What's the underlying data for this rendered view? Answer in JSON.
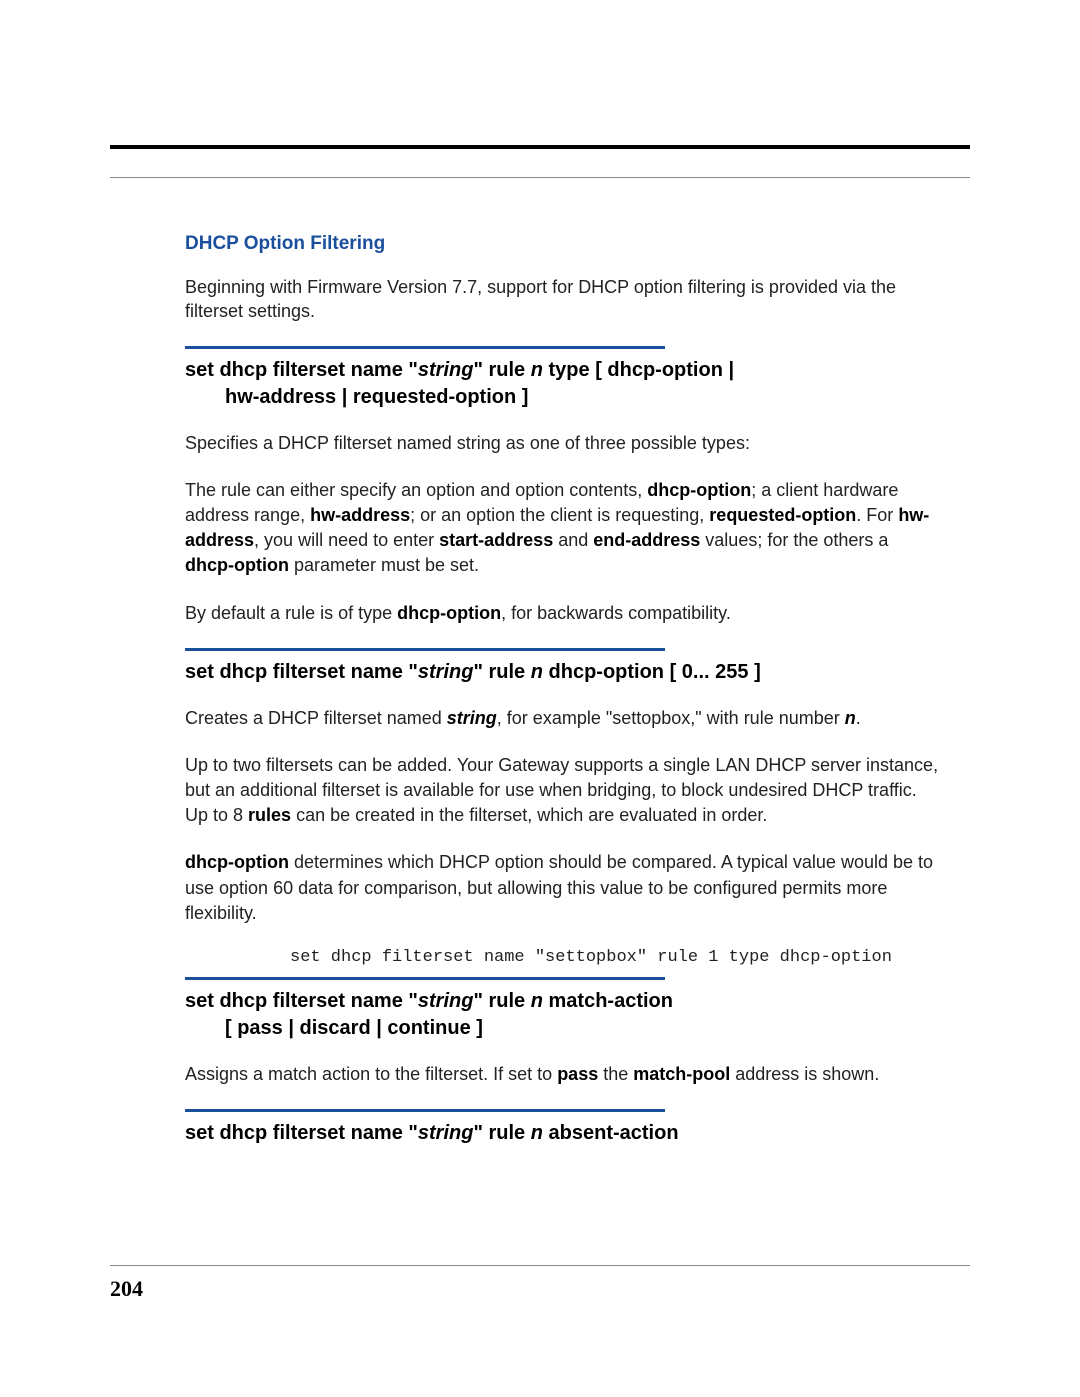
{
  "section": {
    "heading": "DHCP Option Filtering",
    "intro": "Beginning with Firmware Version 7.7, support for DHCP option filtering is provided via the filterset settings."
  },
  "cmd1": {
    "prefix": "set dhcp filterset name \"",
    "param1": "string",
    "mid1": "\" rule ",
    "param2": "n",
    "mid2": " type [ dhcp-option |",
    "line2": "hw-address | requested-option ]",
    "desc": "Specifies a DHCP filterset named string as one of three possible types:",
    "para2_a": "The rule can either specify an option and option contents, ",
    "para2_b": "dhcp-option",
    "para2_c": "; a client hardware address range, ",
    "para2_d": "hw-address",
    "para2_e": "; or an option the client is requesting, ",
    "para2_f": "requested-option",
    "para2_g": ". For ",
    "para2_h": "hw-address",
    "para2_i": ", you will need to enter ",
    "para2_j": "start-address",
    "para2_k": " and ",
    "para2_l": "end-address",
    "para2_m": " values; for the others a ",
    "para2_n": "dhcp-option",
    "para2_o": " parameter must be set.",
    "para3_a": "By default a rule is of type ",
    "para3_b": "dhcp-option",
    "para3_c": ", for backwards compatibility."
  },
  "cmd2": {
    "prefix": "set dhcp filterset name \"",
    "param1": "string",
    "mid1": "\" rule ",
    "param2": "n",
    "suffix": " dhcp-option [ 0...  255 ]",
    "para1_a": "Creates a DHCP filterset named ",
    "para1_b": "string",
    "para1_c": ", for example \"settopbox,\" with rule number ",
    "para1_d": "n",
    "para1_e": ".",
    "para2_a": "Up to two filtersets can be added. Your Gateway supports a single LAN DHCP server instance, but an additional filterset is available for use when bridging, to block undesired DHCP traffic. Up to 8 ",
    "para2_b": "rules",
    "para2_c": " can be created in the filterset, which are evaluated in order.",
    "para3_a": "dhcp-option",
    "para3_b": " determines which DHCP option should be compared. A typical value would be to use option 60 data for comparison, but allowing this value to be configured permits more flexibility.",
    "code": "set dhcp filterset name \"settopbox\" rule 1 type dhcp-option"
  },
  "cmd3": {
    "prefix": "set dhcp filterset name \"",
    "param1": "string",
    "mid1": "\" rule ",
    "param2": "n",
    "suffix": " match-action",
    "line2": "[ pass | discard | continue ]",
    "para_a": "Assigns a match action to the filterset. If set to ",
    "para_b": "pass",
    "para_c": " the ",
    "para_d": "match-pool",
    "para_e": " address is shown."
  },
  "cmd4": {
    "prefix": "set dhcp filterset name \"",
    "param1": "string",
    "mid1": "\" rule ",
    "param2": "n",
    "suffix": " absent-action"
  },
  "footer": {
    "page_number": "204"
  }
}
